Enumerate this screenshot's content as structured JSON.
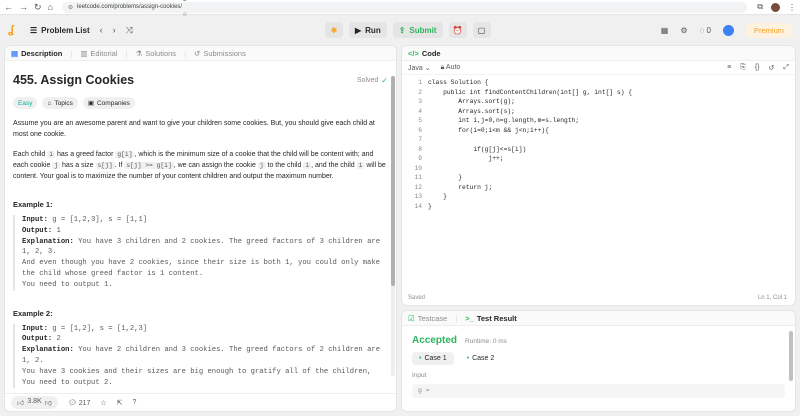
{
  "browser": {
    "url": "leetcode.com/problems/assign-cookies/"
  },
  "topbar": {
    "problem_list": "Problem List",
    "run": "Run",
    "submit": "Submit",
    "coins": "0",
    "premium": "Premium"
  },
  "left_tabs": {
    "description": "Description",
    "editorial": "Editorial",
    "solutions": "Solutions",
    "submissions": "Submissions"
  },
  "problem": {
    "title": "455. Assign Cookies",
    "status": "Solved",
    "tags": {
      "difficulty": "Easy",
      "topics": "Topics",
      "companies": "Companies"
    },
    "p1": "Assume you are an awesome parent and want to give your children some cookies. But, you should give each child at most one cookie.",
    "p2_a": "Each child ",
    "p2_i": "i",
    "p2_b": " has a greed factor ",
    "p2_gi": "g[i]",
    "p2_c": ", which is the minimum size of a cookie that the child will be content with; and each cookie ",
    "p2_j": "j",
    "p2_d": " has a size ",
    "p2_sj": "s[j]",
    "p2_e": ". If ",
    "p2_cond": "s[j] >= g[i]",
    "p2_f": ", we can assign the cookie ",
    "p2_j2": "j",
    "p2_g": " to the child ",
    "p2_i2": "i",
    "p2_h": ", and the child ",
    "p2_i3": "i",
    "p2_k": " will be content. Your goal is to maximize the number of your content children and output the maximum number.",
    "example1": {
      "title": "Example 1:",
      "input_label": "Input:",
      "input": " g = [1,2,3], s = [1,1]",
      "output_label": "Output:",
      "output": " 1",
      "expl_label": "Explanation:",
      "expl": " You have 3 children and 2 cookies. The greed factors of 3 children are 1, 2, 3.\nAnd even though you have 2 cookies, since their size is both 1, you could only make the child whose greed factor is 1 content.\nYou need to output 1."
    },
    "example2": {
      "title": "Example 2:",
      "input_label": "Input:",
      "input": " g = [1,2], s = [1,2,3]",
      "output_label": "Output:",
      "output": " 2",
      "expl_label": "Explanation:",
      "expl": " You have 2 children and 3 cookies. The greed factors of 2 children are 1, 2.\nYou have 3 cookies and their sizes are big enough to gratify all of the children,\nYou need to output 2."
    }
  },
  "footer": {
    "likes": "3.8K",
    "comments": "217"
  },
  "editor": {
    "title": "Code",
    "language": "Java",
    "mode": "Auto",
    "saved": "Saved",
    "position": "Ln 1, Col 1",
    "lines": [
      {
        "n": "1",
        "t": "class Solution {"
      },
      {
        "n": "2",
        "t": "    public int findContentChildren(int[] g, int[] s) {"
      },
      {
        "n": "3",
        "t": "        Arrays.sort(g);"
      },
      {
        "n": "4",
        "t": "        Arrays.sort(s);"
      },
      {
        "n": "5",
        "t": "        int i,j=0,n=g.length,m=s.length;"
      },
      {
        "n": "6",
        "t": "        for(i=0;i<m && j<n;i++){"
      },
      {
        "n": "7",
        "t": ""
      },
      {
        "n": "8",
        "t": "            if(g[j]<=s[i])"
      },
      {
        "n": "9",
        "t": "                j++;"
      },
      {
        "n": "10",
        "t": ""
      },
      {
        "n": "11",
        "t": "        }"
      },
      {
        "n": "12",
        "t": "        return j;"
      },
      {
        "n": "13",
        "t": "    }"
      },
      {
        "n": "14",
        "t": "}"
      }
    ]
  },
  "test": {
    "tab_testcase": "Testcase",
    "tab_result": "Test Result",
    "verdict": "Accepted",
    "runtime": "Runtime: 0 ms",
    "case1": "Case 1",
    "case2": "Case 2",
    "input_label": "Input",
    "input_value": "g ="
  }
}
